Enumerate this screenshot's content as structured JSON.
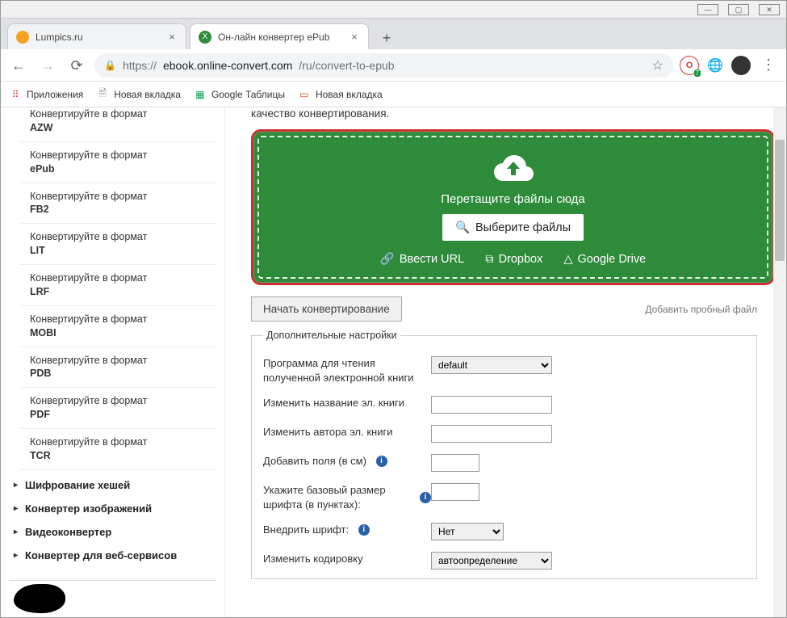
{
  "window": {
    "minimize": "—",
    "maximize": "▢",
    "close": "✕"
  },
  "tabs": [
    {
      "title": "Lumpics.ru",
      "favicon_bg": "#f4a321",
      "favicon_char": ""
    },
    {
      "title": "Он-лайн конвертер ePub",
      "favicon_bg": "#2e8b3a",
      "favicon_char": "X"
    }
  ],
  "newtab": "+",
  "addressbar": {
    "back": "←",
    "forward": "→",
    "reload": "⟳",
    "lock": "🔒",
    "url_prefix": "https://",
    "url_host": "ebook.online-convert.com",
    "url_path": "/ru/convert-to-epub",
    "star": "☆",
    "ext_opera_badge": "7",
    "menu": "⋮"
  },
  "bookmarks": [
    {
      "icon": "⠿",
      "color": "#d24726",
      "label": "Приложения"
    },
    {
      "icon": "🗎",
      "color": "#888",
      "label": "Новая вкладка"
    },
    {
      "icon": "▦",
      "color": "#0f9d58",
      "label": "Google Таблицы"
    },
    {
      "icon": "▭",
      "color": "#d24726",
      "label": "Новая вкладка"
    }
  ],
  "sidebar": {
    "formats": [
      {
        "prefix": "Конвертируйте в формат",
        "name": "AZW",
        "truncated": true
      },
      {
        "prefix": "Конвертируйте в формат",
        "name": "ePub"
      },
      {
        "prefix": "Конвертируйте в формат",
        "name": "FB2"
      },
      {
        "prefix": "Конвертируйте в формат",
        "name": "LIT"
      },
      {
        "prefix": "Конвертируйте в формат",
        "name": "LRF"
      },
      {
        "prefix": "Конвертируйте в формат",
        "name": "MOBI"
      },
      {
        "prefix": "Конвертируйте в формат",
        "name": "PDB"
      },
      {
        "prefix": "Конвертируйте в формат",
        "name": "PDF"
      },
      {
        "prefix": "Конвертируйте в формат",
        "name": "TCR"
      }
    ],
    "categories": [
      "Шифрование хешей",
      "Конвертер изображений",
      "Видеоконвертер",
      "Конвертер для веб-сервисов"
    ]
  },
  "main": {
    "quality_text": "качество конвертирования.",
    "dropzone": {
      "drag_text": "Перетащите файлы сюда",
      "choose_button": "Выберите файлы",
      "sources": {
        "url": "Ввести URL",
        "dropbox": "Dropbox",
        "gdrive": "Google Drive"
      }
    },
    "start_button": "Начать конвертирование",
    "trial_link": "Добавить пробный файл",
    "settings": {
      "legend": "Дополнительные настройки",
      "rows": {
        "reader": {
          "label": "Программа для чтения полученной электронной книги",
          "value": "default"
        },
        "title": {
          "label": "Изменить название эл. книги"
        },
        "author": {
          "label": "Изменить автора эл. книги"
        },
        "margins": {
          "label": "Добавить поля (в см)"
        },
        "fontsize": {
          "label": "Укажите базовый размер шрифта (в пунктах):"
        },
        "embed_font": {
          "label": "Внедрить шрифт:",
          "value": "Нет"
        },
        "encoding": {
          "label": "Изменить кодировку",
          "value": "автоопределение"
        }
      }
    }
  }
}
